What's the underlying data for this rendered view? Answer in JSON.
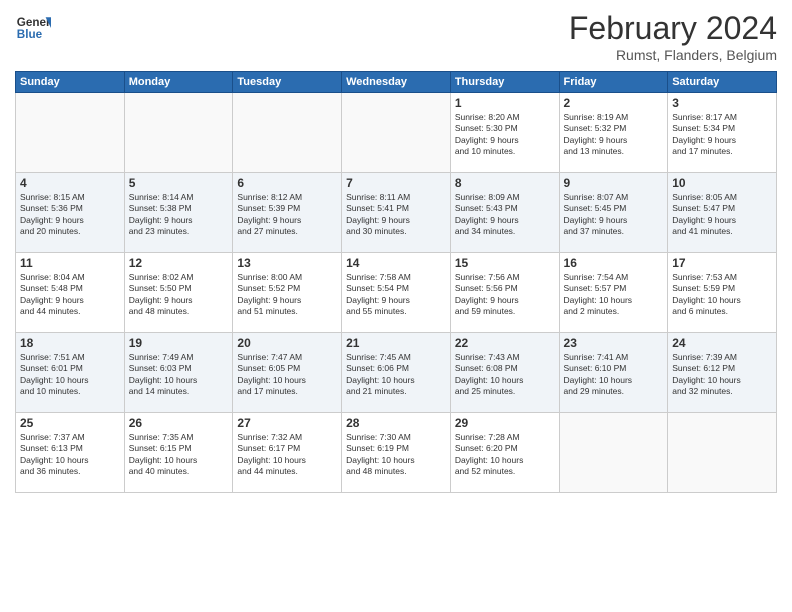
{
  "header": {
    "logo_line1": "General",
    "logo_line2": "Blue",
    "month_year": "February 2024",
    "location": "Rumst, Flanders, Belgium"
  },
  "weekdays": [
    "Sunday",
    "Monday",
    "Tuesday",
    "Wednesday",
    "Thursday",
    "Friday",
    "Saturday"
  ],
  "weeks": [
    [
      {
        "day": "",
        "info": ""
      },
      {
        "day": "",
        "info": ""
      },
      {
        "day": "",
        "info": ""
      },
      {
        "day": "",
        "info": ""
      },
      {
        "day": "1",
        "info": "Sunrise: 8:20 AM\nSunset: 5:30 PM\nDaylight: 9 hours\nand 10 minutes."
      },
      {
        "day": "2",
        "info": "Sunrise: 8:19 AM\nSunset: 5:32 PM\nDaylight: 9 hours\nand 13 minutes."
      },
      {
        "day": "3",
        "info": "Sunrise: 8:17 AM\nSunset: 5:34 PM\nDaylight: 9 hours\nand 17 minutes."
      }
    ],
    [
      {
        "day": "4",
        "info": "Sunrise: 8:15 AM\nSunset: 5:36 PM\nDaylight: 9 hours\nand 20 minutes."
      },
      {
        "day": "5",
        "info": "Sunrise: 8:14 AM\nSunset: 5:38 PM\nDaylight: 9 hours\nand 23 minutes."
      },
      {
        "day": "6",
        "info": "Sunrise: 8:12 AM\nSunset: 5:39 PM\nDaylight: 9 hours\nand 27 minutes."
      },
      {
        "day": "7",
        "info": "Sunrise: 8:11 AM\nSunset: 5:41 PM\nDaylight: 9 hours\nand 30 minutes."
      },
      {
        "day": "8",
        "info": "Sunrise: 8:09 AM\nSunset: 5:43 PM\nDaylight: 9 hours\nand 34 minutes."
      },
      {
        "day": "9",
        "info": "Sunrise: 8:07 AM\nSunset: 5:45 PM\nDaylight: 9 hours\nand 37 minutes."
      },
      {
        "day": "10",
        "info": "Sunrise: 8:05 AM\nSunset: 5:47 PM\nDaylight: 9 hours\nand 41 minutes."
      }
    ],
    [
      {
        "day": "11",
        "info": "Sunrise: 8:04 AM\nSunset: 5:48 PM\nDaylight: 9 hours\nand 44 minutes."
      },
      {
        "day": "12",
        "info": "Sunrise: 8:02 AM\nSunset: 5:50 PM\nDaylight: 9 hours\nand 48 minutes."
      },
      {
        "day": "13",
        "info": "Sunrise: 8:00 AM\nSunset: 5:52 PM\nDaylight: 9 hours\nand 51 minutes."
      },
      {
        "day": "14",
        "info": "Sunrise: 7:58 AM\nSunset: 5:54 PM\nDaylight: 9 hours\nand 55 minutes."
      },
      {
        "day": "15",
        "info": "Sunrise: 7:56 AM\nSunset: 5:56 PM\nDaylight: 9 hours\nand 59 minutes."
      },
      {
        "day": "16",
        "info": "Sunrise: 7:54 AM\nSunset: 5:57 PM\nDaylight: 10 hours\nand 2 minutes."
      },
      {
        "day": "17",
        "info": "Sunrise: 7:53 AM\nSunset: 5:59 PM\nDaylight: 10 hours\nand 6 minutes."
      }
    ],
    [
      {
        "day": "18",
        "info": "Sunrise: 7:51 AM\nSunset: 6:01 PM\nDaylight: 10 hours\nand 10 minutes."
      },
      {
        "day": "19",
        "info": "Sunrise: 7:49 AM\nSunset: 6:03 PM\nDaylight: 10 hours\nand 14 minutes."
      },
      {
        "day": "20",
        "info": "Sunrise: 7:47 AM\nSunset: 6:05 PM\nDaylight: 10 hours\nand 17 minutes."
      },
      {
        "day": "21",
        "info": "Sunrise: 7:45 AM\nSunset: 6:06 PM\nDaylight: 10 hours\nand 21 minutes."
      },
      {
        "day": "22",
        "info": "Sunrise: 7:43 AM\nSunset: 6:08 PM\nDaylight: 10 hours\nand 25 minutes."
      },
      {
        "day": "23",
        "info": "Sunrise: 7:41 AM\nSunset: 6:10 PM\nDaylight: 10 hours\nand 29 minutes."
      },
      {
        "day": "24",
        "info": "Sunrise: 7:39 AM\nSunset: 6:12 PM\nDaylight: 10 hours\nand 32 minutes."
      }
    ],
    [
      {
        "day": "25",
        "info": "Sunrise: 7:37 AM\nSunset: 6:13 PM\nDaylight: 10 hours\nand 36 minutes."
      },
      {
        "day": "26",
        "info": "Sunrise: 7:35 AM\nSunset: 6:15 PM\nDaylight: 10 hours\nand 40 minutes."
      },
      {
        "day": "27",
        "info": "Sunrise: 7:32 AM\nSunset: 6:17 PM\nDaylight: 10 hours\nand 44 minutes."
      },
      {
        "day": "28",
        "info": "Sunrise: 7:30 AM\nSunset: 6:19 PM\nDaylight: 10 hours\nand 48 minutes."
      },
      {
        "day": "29",
        "info": "Sunrise: 7:28 AM\nSunset: 6:20 PM\nDaylight: 10 hours\nand 52 minutes."
      },
      {
        "day": "",
        "info": ""
      },
      {
        "day": "",
        "info": ""
      }
    ]
  ]
}
